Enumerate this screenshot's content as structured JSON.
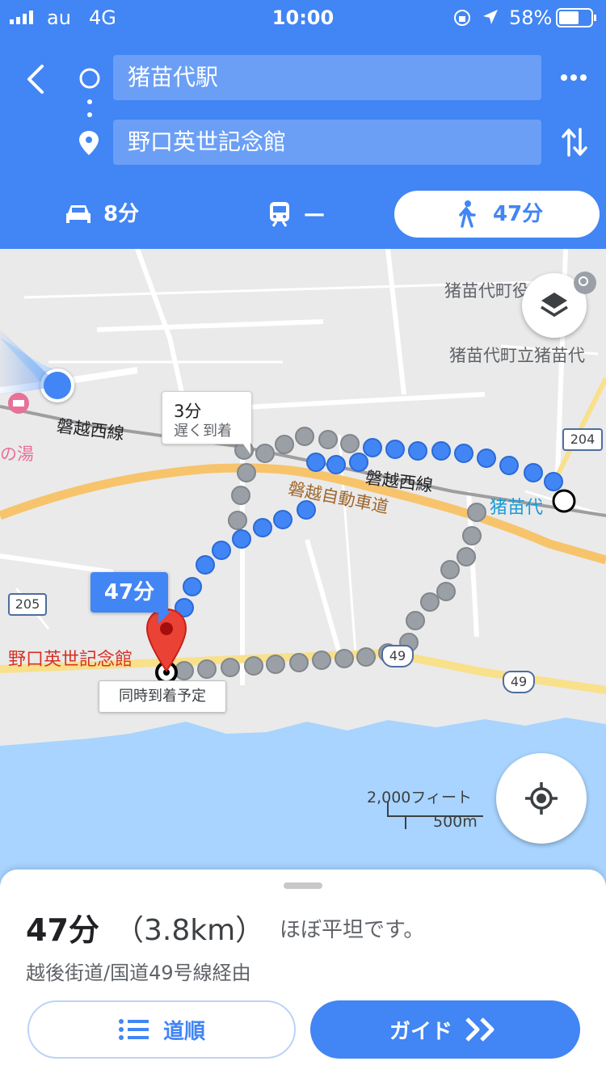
{
  "status_bar": {
    "carrier": "au",
    "network": "4G",
    "time": "10:00",
    "battery": "58%"
  },
  "header": {
    "origin": "猪苗代駅",
    "destination": "野口英世記念館"
  },
  "modes": {
    "car": "8分",
    "transit": "—",
    "walk": "47分"
  },
  "map": {
    "callout_3min_time": "3分",
    "callout_3min_note": "遅く到着",
    "callout_47min": "47分",
    "callout_same": "同時到着予定",
    "place_dest": "野口英世記念館",
    "place_station": "猪苗代",
    "place_town1": "猪苗代町役",
    "place_town2": "猪苗代町立猪苗代",
    "rail1": "磐越西線",
    "rail2": "磐越西線",
    "expressway": "磐越自動車道",
    "hot_spring": "の湯",
    "shield_204": "204",
    "shield_205": "205",
    "shield_49a": "49",
    "shield_49b": "49",
    "scale_ft": "2,000フィート",
    "scale_m": "500m"
  },
  "summary": {
    "duration": "47分",
    "distance": "（3.8km）",
    "terrain": "ほぼ平坦です。",
    "via": "越後街道/国道49号線経由"
  },
  "buttons": {
    "steps": "道順",
    "guide": "ガイド"
  },
  "colors": {
    "accent": "#4285f4",
    "water": "#a8d4ff",
    "route_gray": "#9aa0a6",
    "dest_red": "#ea4335"
  }
}
